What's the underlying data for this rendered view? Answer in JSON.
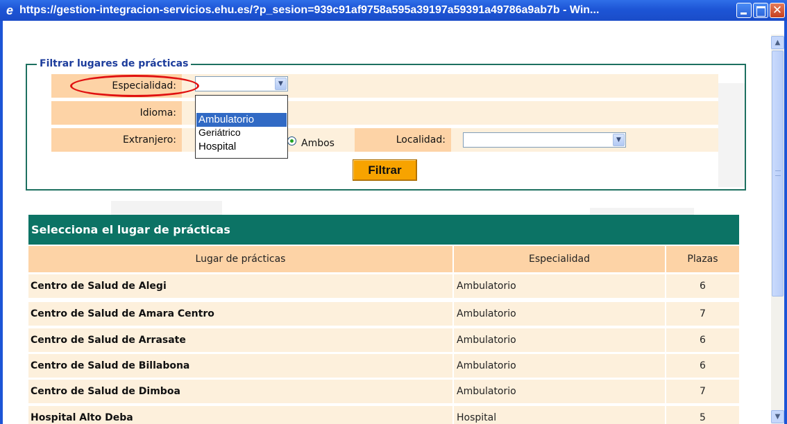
{
  "window": {
    "title": "https://gestion-integracion-servicios.ehu.es/?p_sesion=939c91af9758a595a39197a59391a49786a9ab7b - Win...",
    "close_glyph": "✕"
  },
  "filter": {
    "legend": "Filtrar lugares de prácticas",
    "especialidad_label": "Especialidad:",
    "especialidad_value": "",
    "idioma_label": "Idioma:",
    "extranjero_label": "Extranjero:",
    "radio_selected_label": "Ambos",
    "localidad_label": "Localidad:",
    "localidad_value": "",
    "filtrar_button": "Filtrar",
    "dropdown_options": [
      "",
      "Ambulatorio",
      "Geriátrico",
      "Hospital"
    ],
    "dropdown_highlighted": "Ambulatorio"
  },
  "results": {
    "title": "Selecciona el lugar de prácticas",
    "columns": [
      "Lugar de prácticas",
      "Especialidad",
      "Plazas"
    ],
    "rows": [
      {
        "lugar": "Centro de Salud de Alegi",
        "especialidad": "Ambulatorio",
        "plazas": "6"
      },
      {
        "lugar": "Centro de Salud de Amara Centro",
        "especialidad": "Ambulatorio",
        "plazas": "7"
      },
      {
        "lugar": "Centro de Salud de Arrasate",
        "especialidad": "Ambulatorio",
        "plazas": "6"
      },
      {
        "lugar": "Centro de Salud de Billabona",
        "especialidad": "Ambulatorio",
        "plazas": "6"
      },
      {
        "lugar": "Centro de Salud de Dimboa",
        "especialidad": "Ambulatorio",
        "plazas": "7"
      },
      {
        "lugar": "Hospital Alto Deba",
        "especialidad": "Hospital",
        "plazas": "5"
      }
    ]
  },
  "colors": {
    "titlebar": "#1d55d6",
    "section_header": "#0c7365",
    "label_bg": "#fdd3a6",
    "row_bg": "#fdf0dc",
    "button": "#f7a300",
    "annotation_ellipse": "#e01010"
  },
  "icons": {
    "browser": "internet-explorer-icon",
    "scroll_up": "chevron-up-icon",
    "scroll_down": "chevron-down-icon",
    "select_arrow": "chevron-down-icon"
  }
}
